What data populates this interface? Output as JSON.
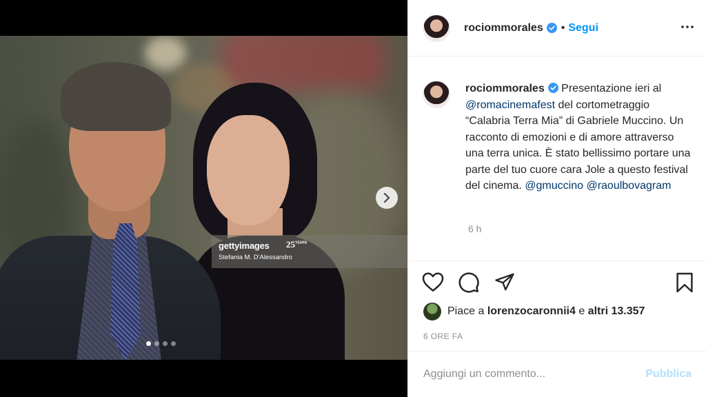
{
  "post": {
    "username": "rociommorales",
    "verified": true,
    "follow_label": "Segui",
    "separator": "•"
  },
  "media": {
    "watermark_logo": "gettyimages",
    "watermark_badge": "25",
    "watermark_badge_sub": "YEARS",
    "photographer": "Stefania M. D'Alessandro",
    "carousel_total": 4,
    "carousel_active": 1
  },
  "caption": {
    "username": "rociommorales",
    "text_1": "Presentazione ieri al",
    "mention_1": "@romacinemafest",
    "text_2": "del cortometraggio “Calabria Terra Mia” di Gabriele Muccino. Un racconto di emozioni e di amore attraverso una terra unica. È stato bellissimo portare una parte del tuo cuore cara Jole a questo festival del cinema.",
    "mention_2": "@gmuccino",
    "mention_3": "@raoulbovagram",
    "time": "6 h"
  },
  "likes": {
    "prefix": "Piace a",
    "user": "lorenzocaronnii4",
    "joiner": "e",
    "others": "altri 13.357"
  },
  "timestamp": "6 ORE FA",
  "comment": {
    "placeholder": "Aggiungi un commento...",
    "publish_label": "Pubblica"
  },
  "colors": {
    "accent": "#0095f6",
    "publish_disabled": "#b2dffc",
    "secondary_text": "#8e8e8e"
  }
}
